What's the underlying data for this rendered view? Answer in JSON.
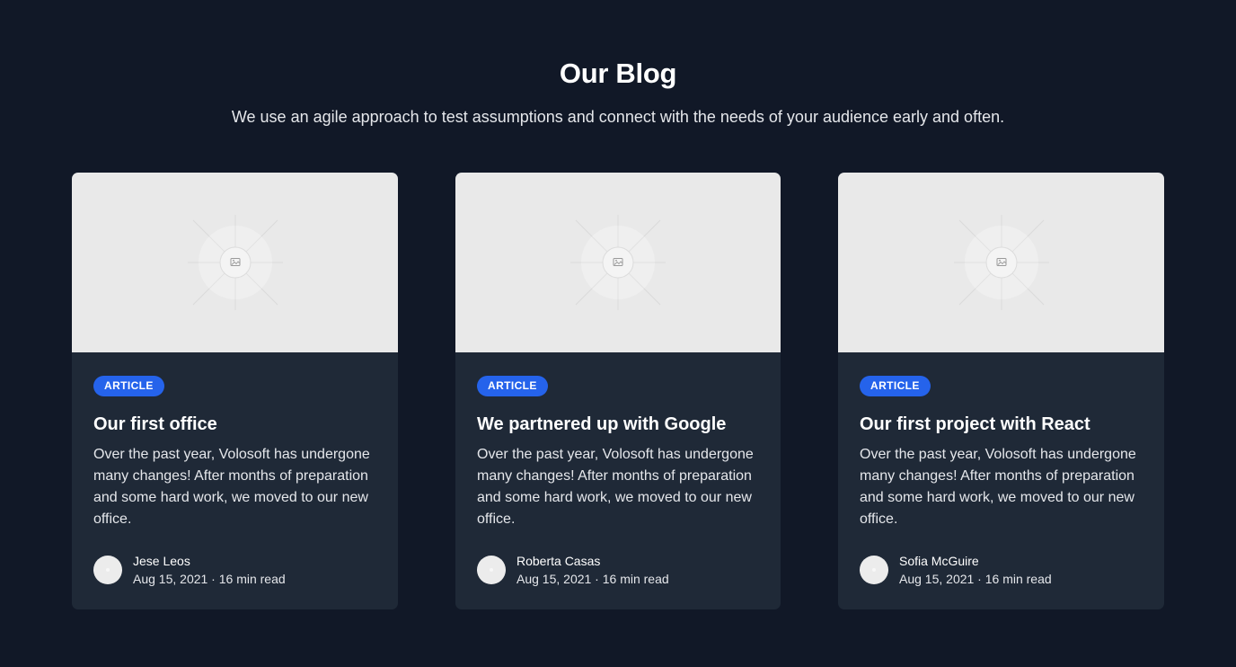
{
  "header": {
    "title": "Our Blog",
    "subtitle": "We use an agile approach to test assumptions and connect with the needs of your audience early and often."
  },
  "colors": {
    "background": "#111827",
    "card": "#1f2937",
    "badge": "#2563eb",
    "placeholder": "#e9e9e9"
  },
  "posts": [
    {
      "badge": "ARTICLE",
      "title": "Our first office",
      "excerpt": "Over the past year, Volosoft has undergone many changes! After months of preparation and some hard work, we moved to our new office.",
      "author": "Jese Leos",
      "meta": "Aug 15, 2021 · 16 min read",
      "image_icon": "image-placeholder-icon"
    },
    {
      "badge": "ARTICLE",
      "title": "We partnered up with Google",
      "excerpt": "Over the past year, Volosoft has undergone many changes! After months of preparation and some hard work, we moved to our new office.",
      "author": "Roberta Casas",
      "meta": "Aug 15, 2021 · 16 min read",
      "image_icon": "image-placeholder-icon"
    },
    {
      "badge": "ARTICLE",
      "title": "Our first project with React",
      "excerpt": "Over the past year, Volosoft has undergone many changes! After months of preparation and some hard work, we moved to our new office.",
      "author": "Sofia McGuire",
      "meta": "Aug 15, 2021 · 16 min read",
      "image_icon": "image-placeholder-icon"
    }
  ]
}
